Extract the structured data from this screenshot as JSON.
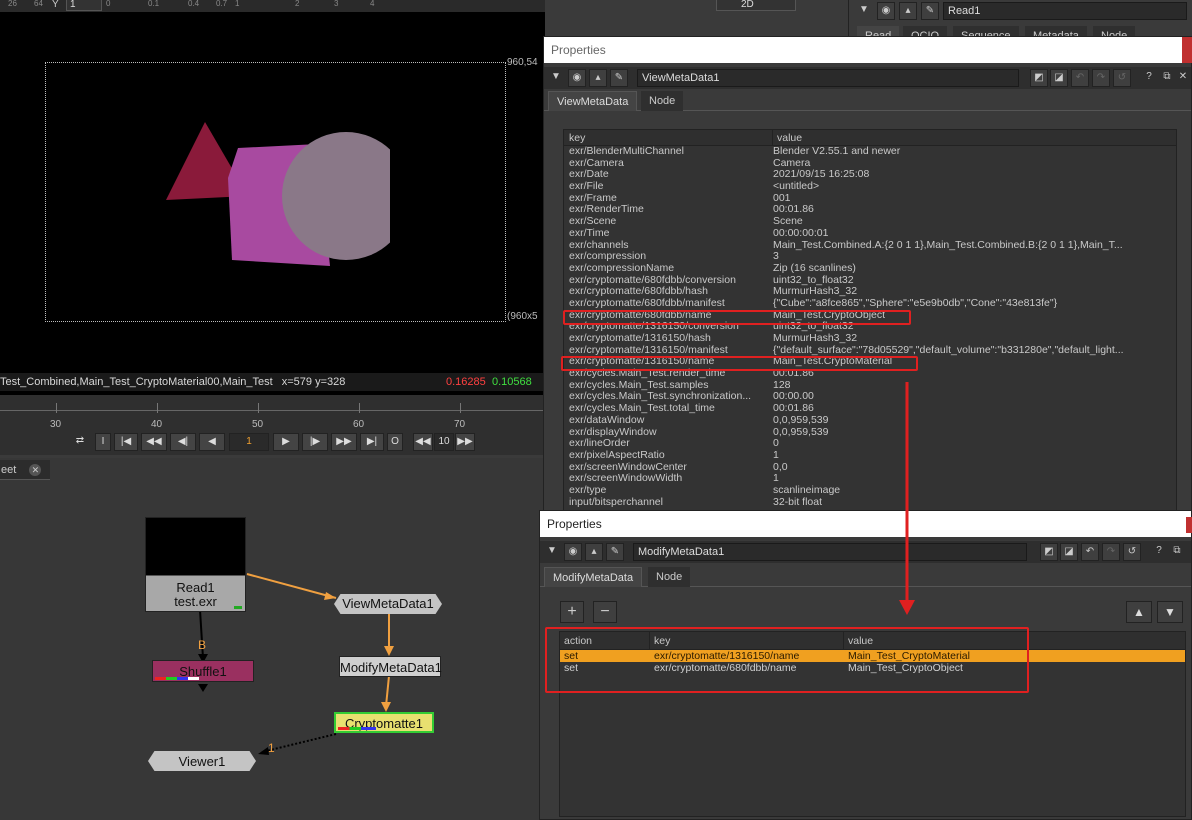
{
  "viewer": {
    "top_bar": {
      "y_label": "Y",
      "y_value": "1",
      "scale_marks": [
        "26",
        "64",
        "0",
        "0.1",
        "0.4",
        "0.7",
        "1",
        "2",
        "3",
        "4"
      ],
      "view_mode": "2D"
    },
    "format_top_right": "960,54",
    "format_bottom_right": "(960x5",
    "status": {
      "layers": "Test_Combined,Main_Test_CryptoMaterial00,Main_Test",
      "coords": "x=579 y=328",
      "r": "0.16285",
      "g": "0.10568"
    },
    "colors": {
      "cone": "#8a1a3a",
      "cube": "#a84aa0",
      "sphere": "#8a7888"
    }
  },
  "timeline": {
    "ticks": [
      "30",
      "40",
      "50",
      "60",
      "70"
    ],
    "current_frame": "1",
    "step": "10",
    "buttons": [
      "⇄",
      "I",
      "|◀",
      "◀◀",
      "◀|",
      "◀",
      "▶",
      "|▶",
      "▶▶",
      "▶|",
      "O",
      "◀◀",
      "▶▶"
    ]
  },
  "node_graph": {
    "tab_label": "eet",
    "nodes": {
      "read": {
        "name": "Read1",
        "file": "test.exr"
      },
      "view_meta": "ViewMetaData1",
      "modify_meta": "ModifyMetaData1",
      "shuffle": "Shuffle1",
      "crypto": "Cryptomatte1",
      "viewer": "Viewer1"
    },
    "edge_labels": {
      "b": "B",
      "one": "1"
    }
  },
  "read_panel": {
    "name": "Read1",
    "tabs": [
      "Read",
      "OCIO",
      "Sequence",
      "Metadata",
      "Node"
    ]
  },
  "view_panel": {
    "title": "Properties",
    "node_name": "ViewMetaData1",
    "tabs": [
      "ViewMetaData",
      "Node"
    ],
    "col_key": "key",
    "col_value": "value",
    "rows": [
      {
        "key": "exr/BlenderMultiChannel",
        "value": "Blender V2.55.1 and newer"
      },
      {
        "key": "exr/Camera",
        "value": "Camera"
      },
      {
        "key": "exr/Date",
        "value": "2021/09/15 16:25:08"
      },
      {
        "key": "exr/File",
        "value": "<untitled>"
      },
      {
        "key": "exr/Frame",
        "value": "001"
      },
      {
        "key": "exr/RenderTime",
        "value": "00:01.86"
      },
      {
        "key": "exr/Scene",
        "value": "Scene"
      },
      {
        "key": "exr/Time",
        "value": "00:00:00:01"
      },
      {
        "key": "exr/channels",
        "value": "Main_Test.Combined.A:{2 0 1 1},Main_Test.Combined.B:{2 0 1 1},Main_T..."
      },
      {
        "key": "exr/compression",
        "value": "3"
      },
      {
        "key": "exr/compressionName",
        "value": "Zip (16 scanlines)"
      },
      {
        "key": "exr/cryptomatte/680fdbb/conversion",
        "value": "uint32_to_float32"
      },
      {
        "key": "exr/cryptomatte/680fdbb/hash",
        "value": "MurmurHash3_32"
      },
      {
        "key": "exr/cryptomatte/680fdbb/manifest",
        "value": "{\"Cube\":\"a8fce865\",\"Sphere\":\"e5e9b0db\",\"Cone\":\"43e813fe\"}"
      },
      {
        "key": "exr/cryptomatte/680fdbb/name",
        "value": "Main_Test.CryptoObject"
      },
      {
        "key": "exr/cryptomatte/1316150/conversion",
        "value": "uint32_to_float32"
      },
      {
        "key": "exr/cryptomatte/1316150/hash",
        "value": "MurmurHash3_32"
      },
      {
        "key": "exr/cryptomatte/1316150/manifest",
        "value": "{\"default_surface\":\"78d05529\",\"default_volume\":\"b331280e\",\"default_light..."
      },
      {
        "key": "exr/cryptomatte/1316150/name",
        "value": "Main_Test.CryptoMaterial"
      },
      {
        "key": "exr/cycles.Main_Test.render_time",
        "value": "00:01.86"
      },
      {
        "key": "exr/cycles.Main_Test.samples",
        "value": "128"
      },
      {
        "key": "exr/cycles.Main_Test.synchronization...",
        "value": "00:00.00"
      },
      {
        "key": "exr/cycles.Main_Test.total_time",
        "value": "00:01.86"
      },
      {
        "key": "exr/dataWindow",
        "value": "0,0,959,539"
      },
      {
        "key": "exr/displayWindow",
        "value": "0,0,959,539"
      },
      {
        "key": "exr/lineOrder",
        "value": "0"
      },
      {
        "key": "exr/pixelAspectRatio",
        "value": "1"
      },
      {
        "key": "exr/screenWindowCenter",
        "value": "0,0"
      },
      {
        "key": "exr/screenWindowWidth",
        "value": "1"
      },
      {
        "key": "exr/type",
        "value": "scanlineimage"
      },
      {
        "key": "input/bitsperchannel",
        "value": "32-bit float"
      }
    ]
  },
  "modify_panel": {
    "title": "Properties",
    "node_name": "ModifyMetaData1",
    "tabs": [
      "ModifyMetaData",
      "Node"
    ],
    "add_label": "+",
    "remove_label": "−",
    "up_label": "▲",
    "down_label": "▼",
    "col_action": "action",
    "col_key": "key",
    "col_value": "value",
    "rows": [
      {
        "action": "set",
        "key": "exr/cryptomatte/1316150/name",
        "value": "Main_Test_CryptoMaterial",
        "selected": true
      },
      {
        "action": "set",
        "key": "exr/cryptomatte/680fdbb/name",
        "value": "Main_Test_CryptoObject",
        "selected": false
      }
    ]
  }
}
